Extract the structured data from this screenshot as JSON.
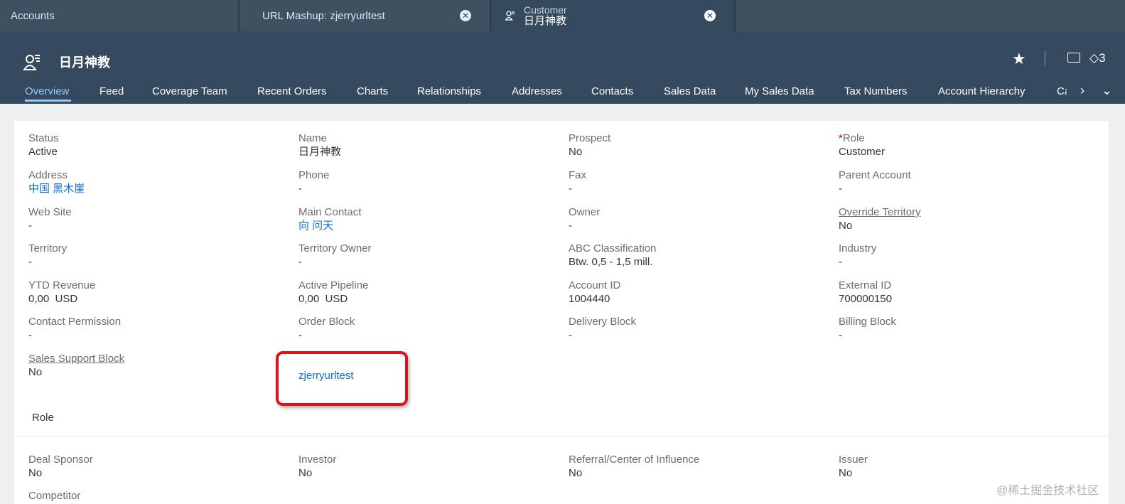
{
  "tabs": {
    "accounts": "Accounts",
    "mashup": "URL Mashup: zjerryurltest",
    "customer_sub": "Customer",
    "customer_main": "日月神教"
  },
  "header": {
    "title": "日月神教",
    "counter": "3"
  },
  "nav": [
    "Overview",
    "Feed",
    "Coverage Team",
    "Recent Orders",
    "Charts",
    "Relationships",
    "Addresses",
    "Contacts",
    "Sales Data",
    "My Sales Data",
    "Tax Numbers",
    "Account Hierarchy",
    "Ca"
  ],
  "fields": {
    "status": {
      "label": "Status",
      "value": "Active"
    },
    "name": {
      "label": "Name",
      "value": "日月神教"
    },
    "prospect": {
      "label": "Prospect",
      "value": "No"
    },
    "role": {
      "label": "Role",
      "value": "Customer",
      "required_mark": "*"
    },
    "address": {
      "label": "Address",
      "value": "中国 黑木崖"
    },
    "phone": {
      "label": "Phone",
      "value": "-"
    },
    "fax": {
      "label": "Fax",
      "value": "-"
    },
    "parent_account": {
      "label": "Parent Account",
      "value": "-"
    },
    "web_site": {
      "label": "Web Site",
      "value": "-"
    },
    "main_contact": {
      "label": "Main Contact",
      "value": "向 问天"
    },
    "owner": {
      "label": "Owner",
      "value": "-"
    },
    "override_territory": {
      "label": "Override Territory",
      "value": "No"
    },
    "territory": {
      "label": "Territory",
      "value": "-"
    },
    "territory_owner": {
      "label": "Territory Owner",
      "value": "-"
    },
    "abc_classification": {
      "label": "ABC Classification",
      "value": "Btw. 0,5 - 1,5 mill."
    },
    "industry": {
      "label": "Industry",
      "value": "-"
    },
    "ytd_revenue": {
      "label": "YTD Revenue",
      "value": "0,00  USD"
    },
    "active_pipeline": {
      "label": "Active Pipeline",
      "value": "0,00  USD"
    },
    "account_id": {
      "label": "Account ID",
      "value": "1004440"
    },
    "external_id": {
      "label": "External ID",
      "value": "700000150"
    },
    "contact_permission": {
      "label": "Contact Permission",
      "value": "-"
    },
    "order_block": {
      "label": "Order Block",
      "value": "-"
    },
    "delivery_block": {
      "label": "Delivery Block",
      "value": "-"
    },
    "billing_block": {
      "label": "Billing Block",
      "value": "-"
    },
    "sales_support_block": {
      "label": "Sales Support Block",
      "value": "No"
    }
  },
  "mashup_link": "zjerryurltest",
  "role_section": {
    "title": "Role",
    "deal_sponsor": {
      "label": "Deal Sponsor",
      "value": "No"
    },
    "investor": {
      "label": "Investor",
      "value": "No"
    },
    "referral": {
      "label": "Referral/Center of Influence",
      "value": "No"
    },
    "issuer": {
      "label": "Issuer",
      "value": "No"
    },
    "competitor": {
      "label": "Competitor"
    }
  },
  "watermark": "@稀土掘金技术社区"
}
